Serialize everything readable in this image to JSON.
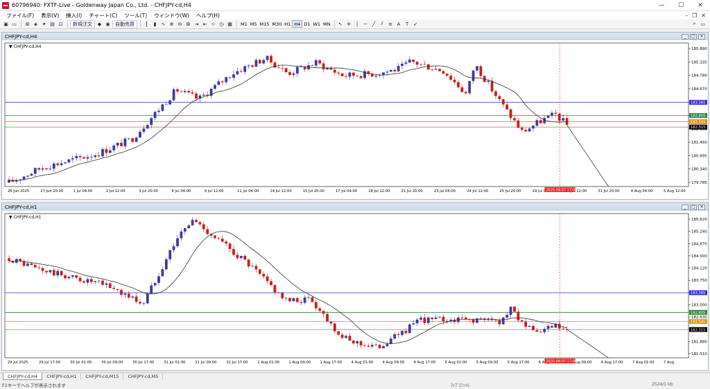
{
  "window": {
    "title": "60796940: FXTF-Live - Goldenway Japan Co., Ltd. - CHFJPY-cd,H4",
    "minimize": "—",
    "maximize": "☐",
    "close": "✕"
  },
  "menu": {
    "items": [
      "ファイル(F)",
      "表示(V)",
      "挿入(I)",
      "チャート(C)",
      "ツール(T)",
      "ウィンドウ(W)",
      "ヘルプ(H)"
    ],
    "right_icons": [
      "–",
      "❐",
      "✕"
    ]
  },
  "toolbar": {
    "new_order": "新規注文",
    "auto_trade": "自動売買",
    "timeframes": [
      "M1",
      "M5",
      "M15",
      "M30",
      "H1",
      "H4",
      "D1",
      "W1",
      "MN"
    ],
    "active_timeframe": "H4"
  },
  "charts": [
    {
      "window_title": "CHFJPY-cd,H4",
      "label": "CHFJPY-cd,H4",
      "price_labels": [
        "185.890",
        "185.335",
        "184.780",
        "184.670",
        "183.670",
        "183.115",
        "182.005",
        "181.450",
        "180.895",
        "180.340",
        "179.785"
      ],
      "hline_labels": [
        {
          "text": "183.365",
          "color": "#3333cc"
        },
        {
          "text": "182.805",
          "color": "#2e8b3c"
        },
        {
          "text": "182.545",
          "color": "#e59400"
        },
        {
          "text": "182.315",
          "color": "#000000"
        }
      ],
      "time_labels": [
        "26 Jun 2025",
        "27 Jun 20:00",
        "1 Jul 04:00",
        "2 Jul 12:00",
        "3 Jul 20:00",
        "8 Jul 04:00",
        "9 Jul 12:00",
        "11 Jul 04:00",
        "14 Jul 12:00",
        "15 Jul 20:00",
        "17 Jul 04:00",
        "18 Jul 12:00",
        "21 Jul 20:00",
        "23 Jul 04:00",
        "24 Jul 12:00",
        "25 Jul 20:00",
        "29 Jul 04:00",
        "30 Jul 12:00",
        "31 Jul 20:00",
        "4 Aug 04:00",
        "5 Aug 12:00"
      ],
      "cursor_time": "2025.08.07 17:00",
      "x_range": [
        "26 Jun 2025",
        "5 Aug 12:00"
      ],
      "y_range": [
        179.785,
        185.89
      ]
    },
    {
      "window_title": "CHFJPY-cd,H1",
      "label": "CHFJPY-cd,H1",
      "price_labels": [
        "185.620",
        "185.240",
        "184.870",
        "184.500",
        "184.120",
        "183.750",
        "183.370",
        "183.000",
        "182.630",
        "182.260",
        "181.880",
        "181.510"
      ],
      "hline_labels": [
        {
          "text": "183.365",
          "color": "#3333cc"
        },
        {
          "text": "182.805",
          "color": "#2e8b3c"
        },
        {
          "text": "182.545",
          "color": "#e59400"
        },
        {
          "text": "182.315",
          "color": "#000000"
        }
      ],
      "time_labels": [
        "29 Jul 2025",
        "29 Jul 17:00",
        "30 Jul 01:00",
        "30 Jul 09:00",
        "30 Jul 17:00",
        "31 Jul 01:00",
        "31 Jul 09:00",
        "31 Jul 17:00",
        "1 Aug 01:00",
        "1 Aug 09:00",
        "1 Aug 17:00",
        "4 Aug 01:00",
        "4 Aug 09:00",
        "4 Aug 17:00",
        "5 Aug 01:00",
        "5 Aug 09:00",
        "5 Aug 17:00",
        "6 Aug 01:00",
        "6 Aug 09:00",
        "6 Aug 17:00",
        "7 Aug 01:00",
        "7 Aug"
      ],
      "cursor_time": "2025.08.07 17:00",
      "x_range": [
        "29 Jul 2025",
        "7 Aug"
      ],
      "y_range": [
        181.51,
        185.62
      ]
    }
  ],
  "colors": {
    "bull": "#3c3c9c",
    "bear": "#c81e1e",
    "blue_line": "#3333cc",
    "green_line": "#2e8b3c",
    "orange_line": "#e59400",
    "cursor": "#ff2020"
  },
  "tabs": [
    "CHFJPY-cd,H4",
    "CHFJPY-cd,H1",
    "CHFJPY-cd,M15",
    "CHFJPY-cd,M5"
  ],
  "active_tab": "CHFJPY-cd,H4",
  "status": {
    "help": "F1キーでヘルプが表示されます",
    "profile": "ﾏｲﾌﾟﾛﾌｧｲﾙ",
    "connection": "2524/1 kb"
  }
}
